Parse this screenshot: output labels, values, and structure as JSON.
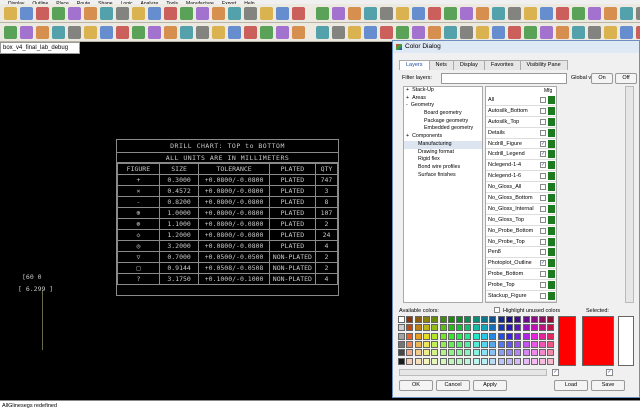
{
  "menubar": {
    "items": [
      "Display",
      "Outline",
      "Place",
      "Route",
      "Shape",
      "Logic",
      "Analyze",
      "Tools",
      "Manufacture",
      "Export",
      "Help"
    ]
  },
  "document_tab": {
    "label": "box_v4_final_lab_debug"
  },
  "drill_chart": {
    "title": "DRILL CHART: TOP to BOTTOM",
    "subtitle": "ALL UNITS ARE IN MILLIMETERS",
    "headers": [
      "FIGURE",
      "SIZE",
      "TOLERANCE",
      "PLATED",
      "QTY"
    ],
    "rows": [
      [
        "+",
        "0.3000",
        "+0.0800/-0.0800",
        "PLATED",
        "747"
      ],
      [
        "×",
        "0.4572",
        "+0.0800/-0.0800",
        "PLATED",
        "3"
      ],
      [
        "-",
        "0.8200",
        "+0.0800/-0.0800",
        "PLATED",
        "8"
      ],
      [
        "⊕",
        "1.0000",
        "+0.0800/-0.0800",
        "PLATED",
        "107"
      ],
      [
        "⊗",
        "1.1000",
        "+0.0800/-0.0800",
        "PLATED",
        "2"
      ],
      [
        "◇",
        "1.2000",
        "+0.0800/-0.0800",
        "PLATED",
        "24"
      ],
      [
        "◎",
        "3.2000",
        "+0.0800/-0.0800",
        "PLATED",
        "4"
      ],
      [
        "▽",
        "0.7000",
        "+0.0500/-0.0500",
        "NON-PLATED",
        "2"
      ],
      [
        "□",
        "0.9144",
        "+0.0508/-0.0508",
        "NON-PLATED",
        "2"
      ],
      [
        "?",
        "3.1750",
        "+0.1000/-0.1000",
        "NON-PLATED",
        "4"
      ]
    ]
  },
  "canvas_labels": {
    "coord_a": "[60 0",
    "coord_b": "[ 6.299 ]"
  },
  "status": {
    "message": "AllGlinesegs redefined"
  },
  "dialog": {
    "title": "Color Dialog",
    "tabs": [
      "Layers",
      "Nets",
      "Display",
      "Favorites",
      "Visibility Pane"
    ],
    "filter_label": "Filter layers:",
    "global_visibility_label": "Global visibility:",
    "on_label": "On",
    "off_label": "Off",
    "tree": [
      {
        "label": "Stack-Up",
        "sign": "+"
      },
      {
        "label": "Areas",
        "sign": "+"
      },
      {
        "label": "Geometry",
        "sign": "-"
      },
      {
        "label": "Board geometry",
        "sign": ""
      },
      {
        "label": "Package geometry",
        "sign": ""
      },
      {
        "label": "Embedded geometry",
        "sign": ""
      },
      {
        "label": "Components",
        "sign": "+"
      },
      {
        "label": "Manufacturing",
        "sign": ""
      },
      {
        "label": "Drawing format",
        "sign": ""
      },
      {
        "label": "Rigid flex",
        "sign": ""
      },
      {
        "label": "Bond wire profiles",
        "sign": ""
      },
      {
        "label": "Surface finishes",
        "sign": ""
      }
    ],
    "layers_header": "Mfg",
    "layers": [
      {
        "name": "All",
        "checked": false
      },
      {
        "name": "Autosilk_Bottom",
        "checked": false
      },
      {
        "name": "Autosilk_Top",
        "checked": false
      },
      {
        "name": "Details",
        "checked": false
      },
      {
        "name": "Ncdrill_Figure",
        "checked": true
      },
      {
        "name": "Ncdrill_Legend",
        "checked": true
      },
      {
        "name": "Nclegend-1-4",
        "checked": true
      },
      {
        "name": "Nclegend-1-6",
        "checked": false
      },
      {
        "name": "No_Gloss_All",
        "checked": false
      },
      {
        "name": "No_Gloss_Bottom",
        "checked": false
      },
      {
        "name": "No_Gloss_Internal",
        "checked": false
      },
      {
        "name": "No_Gloss_Top",
        "checked": false
      },
      {
        "name": "No_Probe_Bottom",
        "checked": false
      },
      {
        "name": "No_Probe_Top",
        "checked": false
      },
      {
        "name": "Pen8",
        "checked": false
      },
      {
        "name": "Photoplot_Outline",
        "checked": true
      },
      {
        "name": "Probe_Bottom",
        "checked": false
      },
      {
        "name": "Probe_Top",
        "checked": false
      },
      {
        "name": "Stackup_Figure",
        "checked": false
      }
    ],
    "available_colors_label": "Available colors:",
    "highlight_label": "Highlight unused colors",
    "selected_label": "Selected:",
    "buttons": {
      "ok": "OK",
      "cancel": "Cancel",
      "apply": "Apply",
      "load": "Load",
      "save": "Save"
    },
    "colors": {
      "selected_color": "#ff0000",
      "swatch_color": "#1e7a1e"
    }
  }
}
